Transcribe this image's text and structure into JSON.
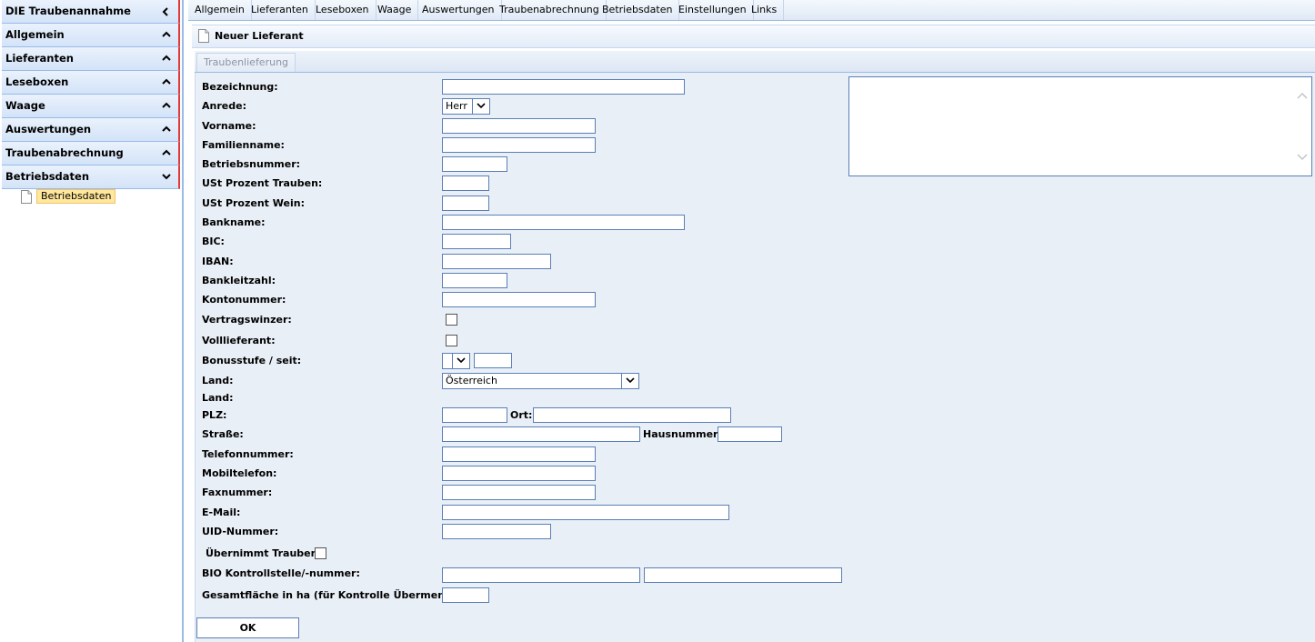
{
  "sidebar": {
    "headers": [
      {
        "label": "DIE Traubenannahme",
        "chevron": "left"
      },
      {
        "label": "Allgemein",
        "chevron": "up"
      },
      {
        "label": "Lieferanten",
        "chevron": "up"
      },
      {
        "label": "Leseboxen",
        "chevron": "up"
      },
      {
        "label": "Waage",
        "chevron": "up"
      },
      {
        "label": "Auswertungen",
        "chevron": "up"
      },
      {
        "label": "Traubenabrechnung",
        "chevron": "up"
      },
      {
        "label": "Betriebsdaten",
        "chevron": "down"
      }
    ],
    "tree_item": "Betriebsdaten"
  },
  "topmenu": [
    "Allgemein",
    "Lieferanten",
    "Leseboxen",
    "Waage",
    "Auswertungen",
    "Traubenabrechnung",
    "Betriebsdaten",
    "Einstellungen",
    "Links"
  ],
  "panel": {
    "title": "Neuer Lieferant",
    "tab": "Traubenlieferung"
  },
  "form": {
    "bezeichnung": "Bezeichnung:",
    "anrede": "Anrede:",
    "anrede_value": "Herr",
    "vorname": "Vorname:",
    "familienname": "Familienname:",
    "betriebsnummer": "Betriebsnummer:",
    "ust_trauben": "USt Prozent Trauben:",
    "ust_wein": "USt Prozent Wein:",
    "bankname": "Bankname:",
    "bic": "BIC:",
    "iban": "IBAN:",
    "bankleitzahl": "Bankleitzahl:",
    "kontonummer": "Kontonummer:",
    "vertragswinzer": "Vertragswinzer:",
    "volllieferant": "Volllieferant:",
    "bonusstufe": "Bonusstufe / seit:",
    "land": "Land:",
    "land_value": "Österreich",
    "land2": "Land:",
    "plz": "PLZ:",
    "ort": "Ort:",
    "strasse": "Straße:",
    "hausnummer": "Hausnummer:",
    "telefonnummer": "Telefonnummer:",
    "mobiltelefon": "Mobiltelefon:",
    "faxnummer": "Faxnummer:",
    "email": "E-Mail:",
    "uid": "UID-Nummer:",
    "uebernimmt": "Übernimmt Trauben:",
    "bio": "BIO Kontrollstelle/-nummer:",
    "gesamtflaeche": "Gesamtfläche in ha (für Kontrolle Übermenge):",
    "ok_label": "OK"
  },
  "colors": {
    "sidebar_accent": "#e23a3a",
    "border_blue": "#99bbe8",
    "tree_highlight": "#ffe79c"
  }
}
